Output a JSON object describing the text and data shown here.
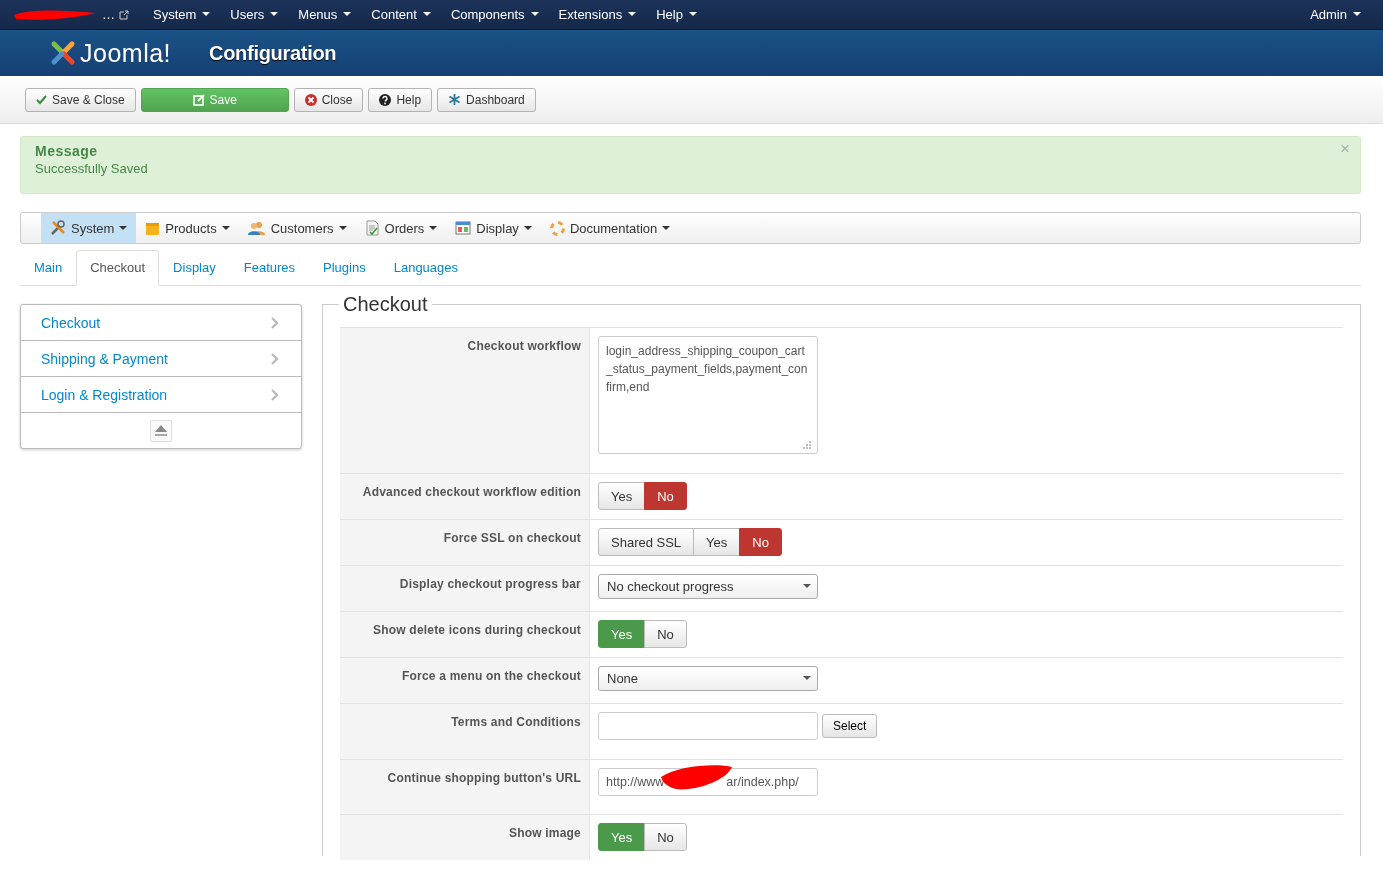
{
  "topbar": {
    "site": "…",
    "menus": [
      {
        "label": "System"
      },
      {
        "label": "Users"
      },
      {
        "label": "Menus"
      },
      {
        "label": "Content"
      },
      {
        "label": "Components"
      },
      {
        "label": "Extensions"
      },
      {
        "label": "Help"
      }
    ],
    "user": "Admin"
  },
  "header": {
    "brand": "Joomla!",
    "title": "Configuration"
  },
  "toolbar": [
    {
      "label": "Save & Close",
      "kind": "check"
    },
    {
      "label": "Save",
      "kind": "save"
    },
    {
      "label": "Close",
      "kind": "close"
    },
    {
      "label": "Help",
      "kind": "help"
    },
    {
      "label": "Dashboard",
      "kind": "dashboard"
    }
  ],
  "message": {
    "heading": "Message",
    "text": "Successfully Saved",
    "close": "×"
  },
  "submenu": [
    {
      "label": "System",
      "kind": "tools",
      "selected": true
    },
    {
      "label": "Products",
      "kind": "box",
      "selected": false
    },
    {
      "label": "Customers",
      "kind": "users",
      "selected": false
    },
    {
      "label": "Orders",
      "kind": "doc",
      "selected": false
    },
    {
      "label": "Display",
      "kind": "window",
      "selected": false
    },
    {
      "label": "Documentation",
      "kind": "help",
      "selected": false
    }
  ],
  "tabs": [
    {
      "label": "Main",
      "selected": false
    },
    {
      "label": "Checkout",
      "selected": true
    },
    {
      "label": "Display",
      "selected": false
    },
    {
      "label": "Features",
      "selected": false
    },
    {
      "label": "Plugins",
      "selected": false
    },
    {
      "label": "Languages",
      "selected": false
    }
  ],
  "sidebar": {
    "items": [
      {
        "label": "Checkout"
      },
      {
        "label": "Shipping & Payment"
      },
      {
        "label": "Login & Registration"
      }
    ]
  },
  "fieldset": {
    "legend": "Checkout",
    "fields": [
      {
        "label": "Checkout workflow",
        "kind": "textarea",
        "value": "login_address_shipping_coupon_cart_status_payment_fields,payment_confirm,end"
      },
      {
        "label": "Advanced checkout workflow edition",
        "kind": "toggle",
        "options": [
          {
            "label": "Yes",
            "selected": false
          },
          {
            "label": "No",
            "selected": true,
            "color": "#bd362f"
          }
        ]
      },
      {
        "label": "Force SSL on checkout",
        "kind": "toggle",
        "options": [
          {
            "label": "Shared SSL",
            "selected": false
          },
          {
            "label": "Yes",
            "selected": false
          },
          {
            "label": "No",
            "selected": true,
            "color": "#bd362f"
          }
        ]
      },
      {
        "label": "Display checkout progress bar",
        "kind": "select",
        "value": "No checkout progress"
      },
      {
        "label": "Show delete icons during checkout",
        "kind": "toggle",
        "options": [
          {
            "label": "Yes",
            "selected": true,
            "color": "#4b9a4b"
          },
          {
            "label": "No",
            "selected": false
          }
        ]
      },
      {
        "label": "Force a menu on the checkout",
        "kind": "select",
        "value": "None"
      },
      {
        "label": "Terms and Conditions",
        "kind": "picker",
        "button": "Select"
      },
      {
        "label": "Continue shopping button's URL",
        "kind": "redacted",
        "visible_parts": [
          "http://www",
          "ar/index.php/"
        ]
      },
      {
        "label": "Show image",
        "kind": "toggle",
        "options": [
          {
            "label": "Yes",
            "selected": true,
            "color": "#4b9a4b"
          },
          {
            "label": "No",
            "selected": false
          }
        ]
      }
    ]
  }
}
